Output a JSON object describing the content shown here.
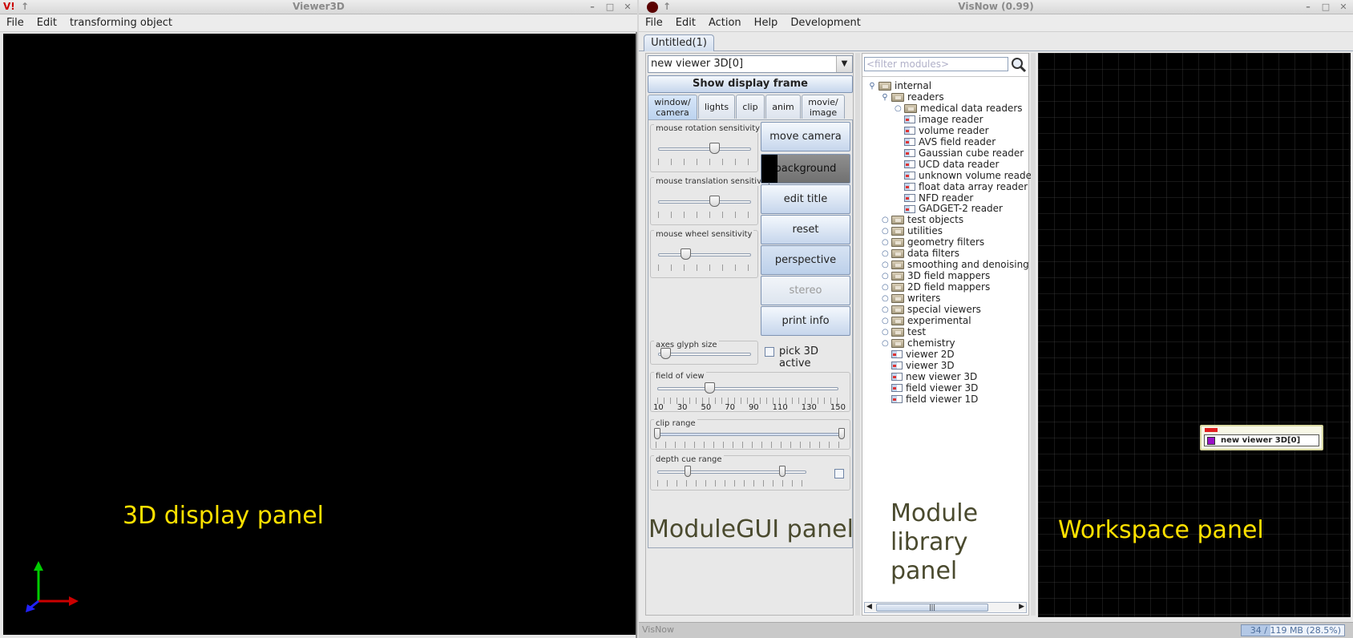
{
  "viewer3d": {
    "title": "Viewer3D",
    "app_icon_text": "V!",
    "menu": [
      "File",
      "Edit",
      "transforming object"
    ],
    "panel_label": "3D display panel"
  },
  "visnow": {
    "title": "VisNow (0.99)",
    "menu": [
      "File",
      "Edit",
      "Action",
      "Help",
      "Development"
    ],
    "doc_tab": "Untitled(1)",
    "module_gui": {
      "module_select": "new viewer 3D[0]",
      "show_frame": "Show display frame",
      "tabs": [
        "window/ camera",
        "lights",
        "clip",
        "anim",
        "movie/ image"
      ],
      "mouse_rotation_label": "mouse rotation sensitivity",
      "mouse_translation_label": "mouse translation sensitivity",
      "mouse_wheel_label": "mouse wheel sensitivity",
      "buttons": {
        "move_camera": "move camera",
        "background": "background",
        "edit_title": "edit title",
        "reset": "reset",
        "perspective": "perspective",
        "stereo": "stereo",
        "print_info": "print info"
      },
      "axes_glyph_label": "axes glyph size",
      "pick_3d_label": "pick 3D active",
      "fov_label": "field of view",
      "fov_ticks": [
        "10",
        "30",
        "50",
        "70",
        "90",
        "110",
        "130",
        "150"
      ],
      "fov_value": 50,
      "clip_range_label": "clip range",
      "depth_cue_label": "depth cue range",
      "panel_label": "ModuleGUI panel"
    },
    "module_library": {
      "filter_placeholder": "<filter modules>",
      "root": "internal",
      "readers_group": "readers",
      "readers": [
        "medical data readers",
        "image reader",
        "volume reader",
        "AVS field reader",
        "Gaussian cube reader",
        "UCD data reader",
        "unknown volume reader",
        "float data array reader",
        "NFD reader",
        "GADGET-2 reader"
      ],
      "groups": [
        "test objects",
        "utilities",
        "geometry filters",
        "data filters",
        "smoothing and denoising",
        "3D field mappers",
        "2D field mappers",
        "writers",
        "special viewers",
        "experimental",
        "test",
        "chemistry"
      ],
      "leaves": [
        "viewer 2D",
        "viewer 3D",
        "new viewer 3D",
        "field viewer 3D",
        "field viewer 1D"
      ],
      "panel_label_1": "Module",
      "panel_label_2": "library",
      "panel_label_3": "panel"
    },
    "workspace": {
      "module_name": "new viewer 3D[0]",
      "panel_label": "Workspace panel"
    },
    "status": {
      "left": "VisNow",
      "memory": "34 / 119 MB (28.5%)",
      "memory_fraction": 0.285
    }
  }
}
